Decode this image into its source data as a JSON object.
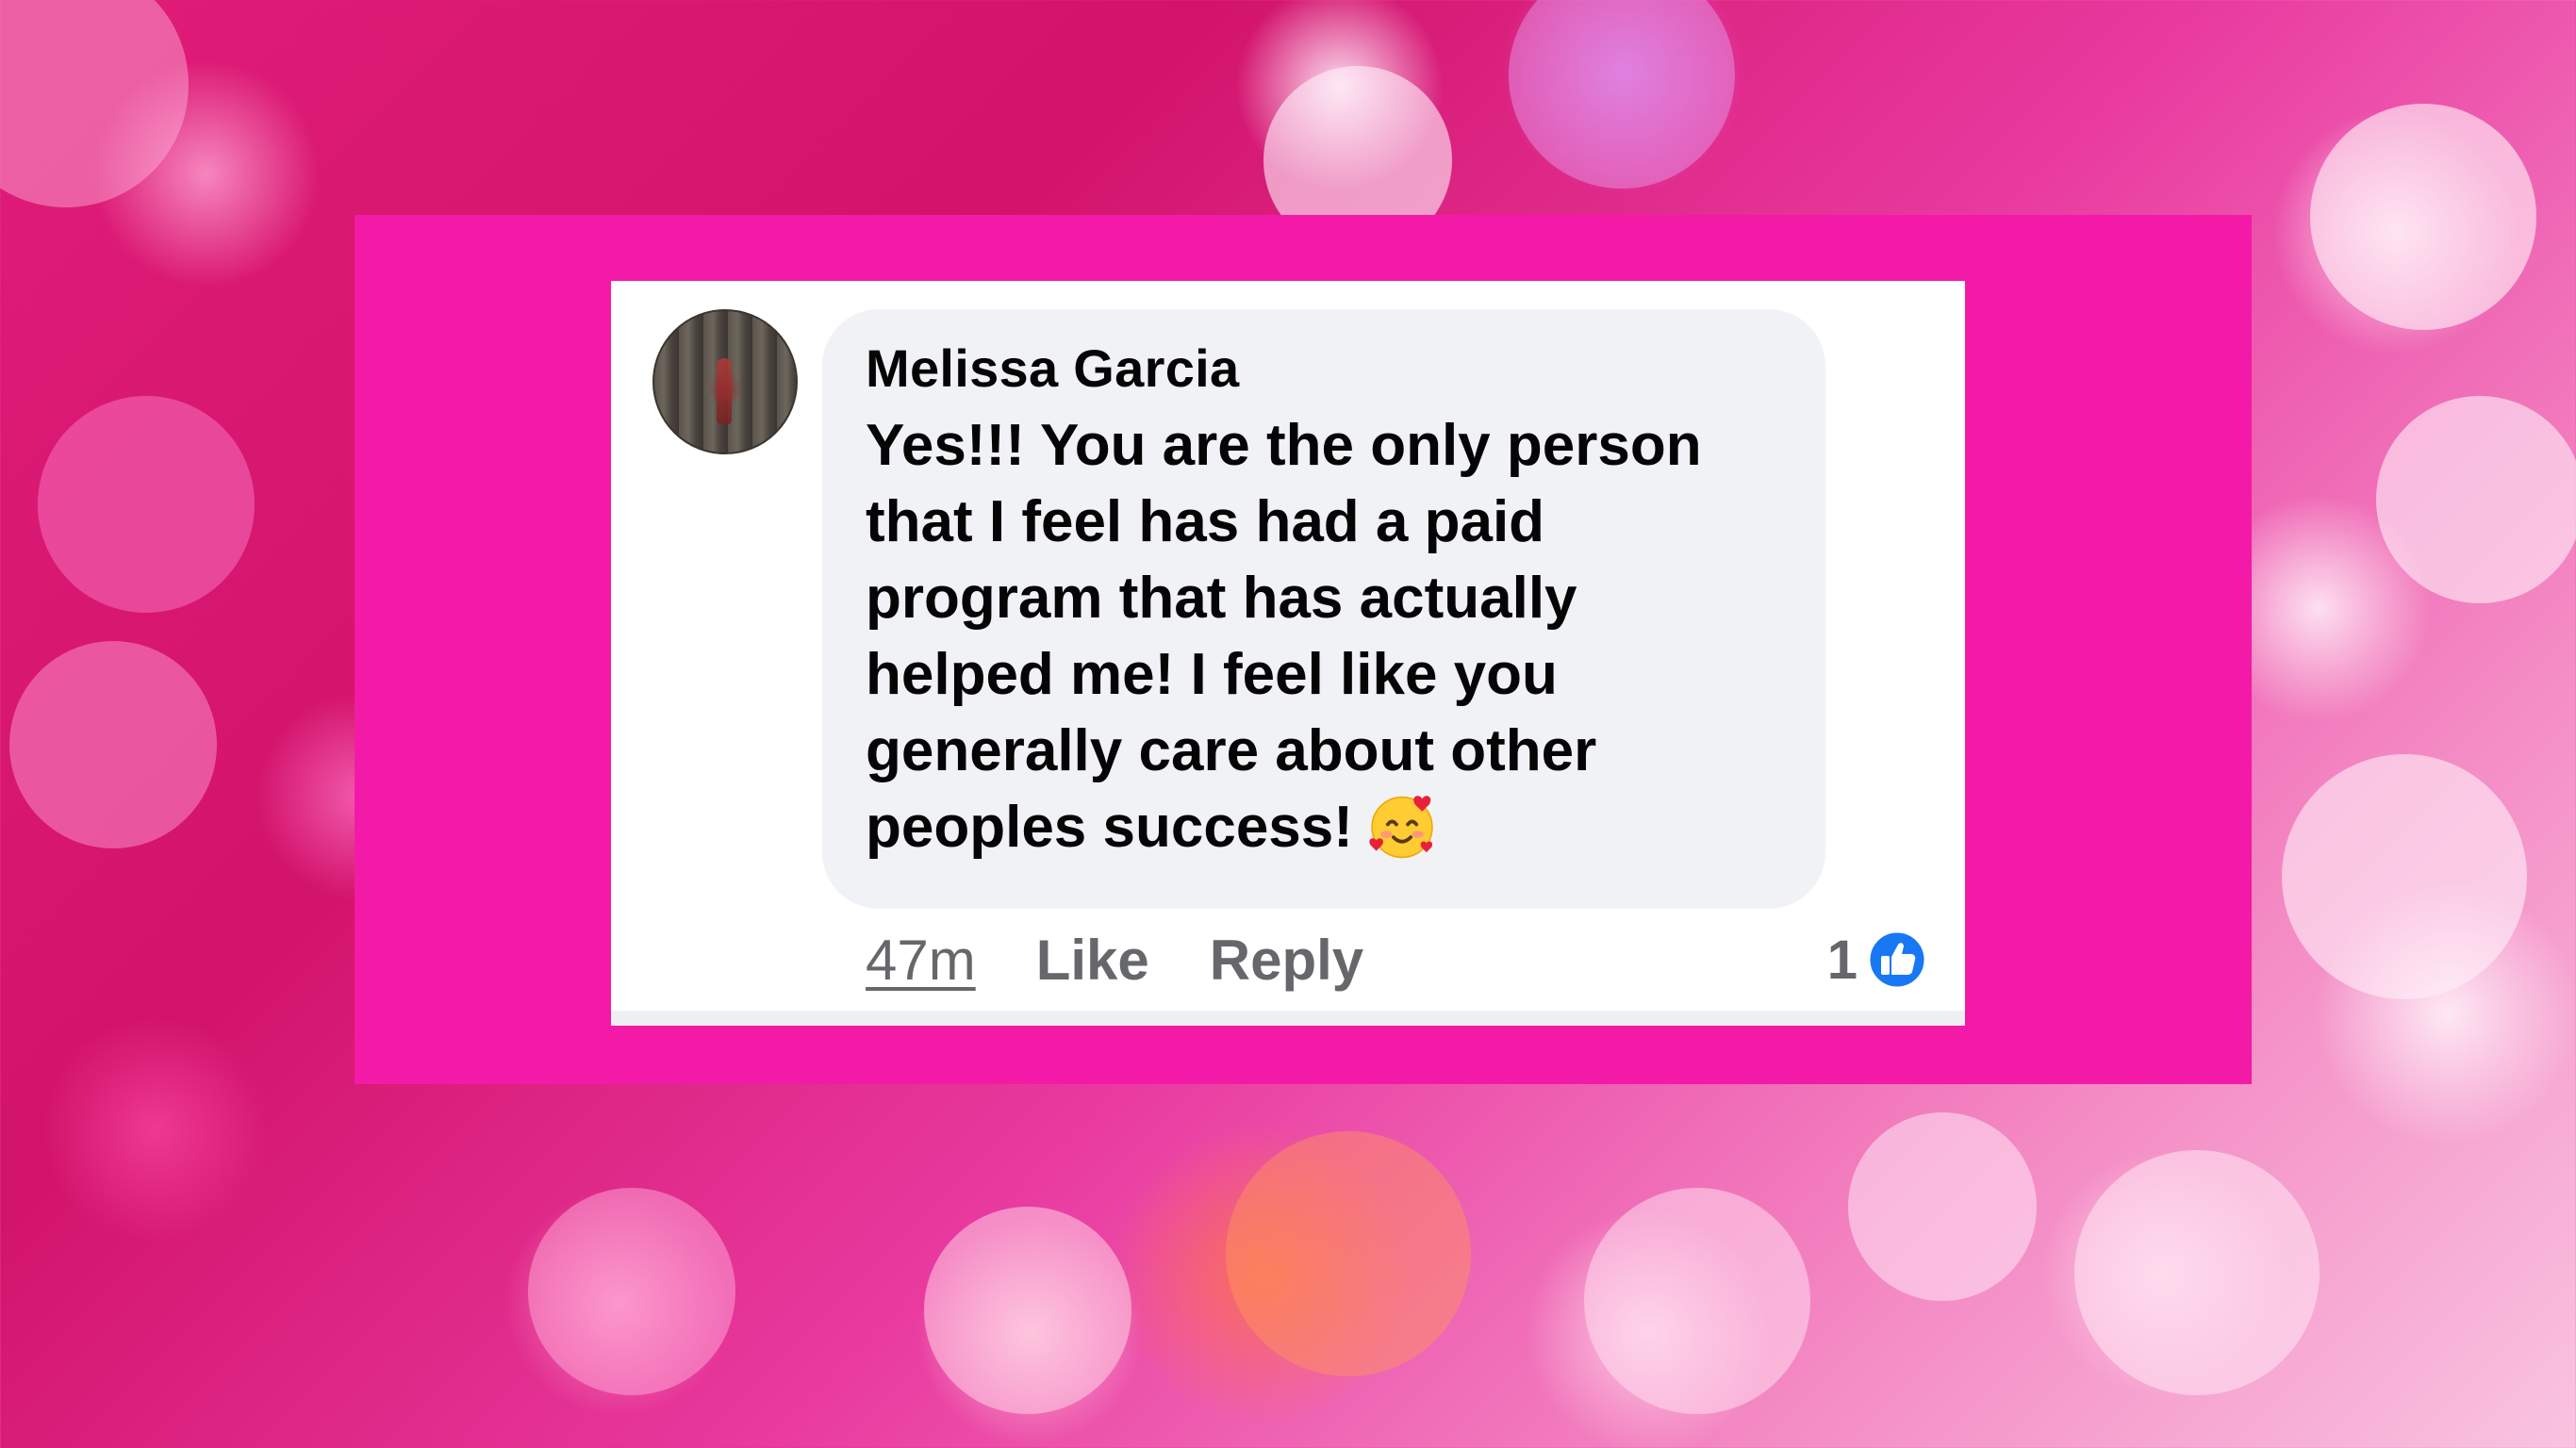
{
  "comment": {
    "author": "Melissa Garcia",
    "lines": [
      "Yes!!! You are the only person",
      "that I feel has had a paid",
      "program that has actually",
      "helped me! I feel like you",
      "generally care about other",
      "peoples success!"
    ],
    "emoji": "smiling-face-with-hearts-icon",
    "time": "47m",
    "like_label": "Like",
    "reply_label": "Reply",
    "reaction_count": "1",
    "reaction_icon": "thumbs-up-icon"
  },
  "colors": {
    "frame": "#f41aa8",
    "bubble": "#f0f2f5",
    "text": "#050505",
    "muted": "#65676b",
    "like_blue": "#1877f2"
  }
}
